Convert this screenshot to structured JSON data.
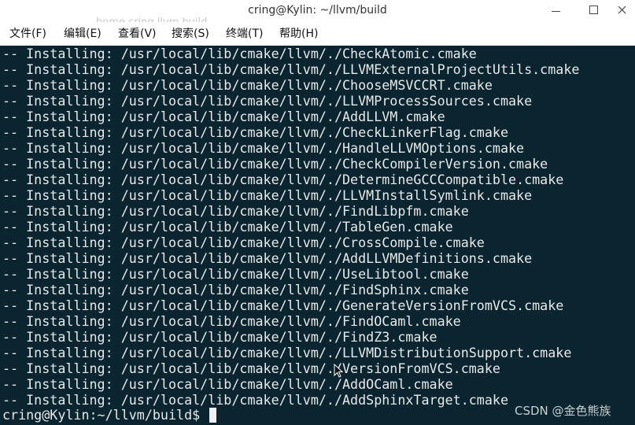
{
  "window": {
    "title": "cring@Kylin: ~/llvm/build",
    "ghost_path": "home  cring  llvm  build"
  },
  "menu": {
    "file": "文件(F)",
    "edit": "编辑(E)",
    "view": "查看(V)",
    "search": "搜索(S)",
    "terminal": "终端(T)",
    "help": "帮助(H)"
  },
  "terminal": {
    "lines": [
      "-- Installing: /usr/local/lib/cmake/llvm/./CheckAtomic.cmake",
      "-- Installing: /usr/local/lib/cmake/llvm/./LLVMExternalProjectUtils.cmake",
      "-- Installing: /usr/local/lib/cmake/llvm/./ChooseMSVCCRT.cmake",
      "-- Installing: /usr/local/lib/cmake/llvm/./LLVMProcessSources.cmake",
      "-- Installing: /usr/local/lib/cmake/llvm/./AddLLVM.cmake",
      "-- Installing: /usr/local/lib/cmake/llvm/./CheckLinkerFlag.cmake",
      "-- Installing: /usr/local/lib/cmake/llvm/./HandleLLVMOptions.cmake",
      "-- Installing: /usr/local/lib/cmake/llvm/./CheckCompilerVersion.cmake",
      "-- Installing: /usr/local/lib/cmake/llvm/./DetermineGCCCompatible.cmake",
      "-- Installing: /usr/local/lib/cmake/llvm/./LLVMInstallSymlink.cmake",
      "-- Installing: /usr/local/lib/cmake/llvm/./FindLibpfm.cmake",
      "-- Installing: /usr/local/lib/cmake/llvm/./TableGen.cmake",
      "-- Installing: /usr/local/lib/cmake/llvm/./CrossCompile.cmake",
      "-- Installing: /usr/local/lib/cmake/llvm/./AddLLVMDefinitions.cmake",
      "-- Installing: /usr/local/lib/cmake/llvm/./UseLibtool.cmake",
      "-- Installing: /usr/local/lib/cmake/llvm/./FindSphinx.cmake",
      "-- Installing: /usr/local/lib/cmake/llvm/./GenerateVersionFromVCS.cmake",
      "-- Installing: /usr/local/lib/cmake/llvm/./FindOCaml.cmake",
      "-- Installing: /usr/local/lib/cmake/llvm/./FindZ3.cmake",
      "-- Installing: /usr/local/lib/cmake/llvm/./LLVMDistributionSupport.cmake",
      "-- Installing: /usr/local/lib/cmake/llvm/./VersionFromVCS.cmake",
      "-- Installing: /usr/local/lib/cmake/llvm/./AddOCaml.cmake",
      "-- Installing: /usr/local/lib/cmake/llvm/./AddSphinxTarget.cmake"
    ],
    "prompt": "cring@Kylin:~/llvm/build$ "
  },
  "watermark": "CSDN @金色熊族",
  "colors": {
    "terminal_bg": "#0a2530",
    "terminal_fg": "#e9e9e9",
    "titlebar_bg": "#ffffff"
  },
  "icons": {
    "minimize": "minimize-icon",
    "maximize": "maximize-icon",
    "close": "close-icon",
    "pointer": "mouse-pointer-icon"
  }
}
